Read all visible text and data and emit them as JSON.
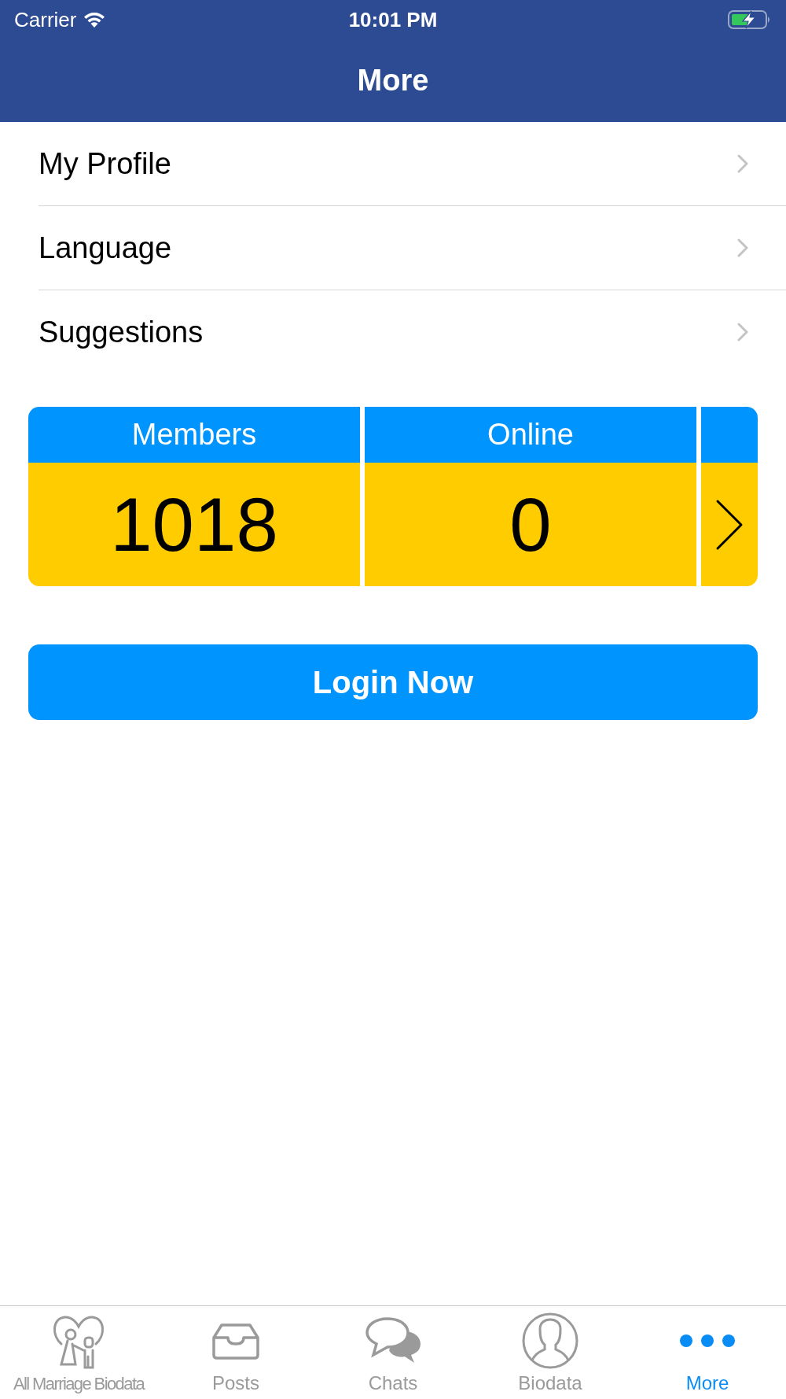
{
  "status_bar": {
    "carrier": "Carrier",
    "time": "10:01 PM"
  },
  "nav": {
    "title": "More"
  },
  "menu": [
    {
      "label": "My Profile"
    },
    {
      "label": "Language"
    },
    {
      "label": "Suggestions"
    }
  ],
  "stats": [
    {
      "label": "Members",
      "value": "1018"
    },
    {
      "label": "Online",
      "value": "0"
    }
  ],
  "login_button": "Login Now",
  "tabs": [
    {
      "label": "All Marriage Biodata",
      "selected": false
    },
    {
      "label": "Posts",
      "selected": false
    },
    {
      "label": "Chats",
      "selected": false
    },
    {
      "label": "Biodata",
      "selected": false
    },
    {
      "label": "More",
      "selected": true
    }
  ]
}
